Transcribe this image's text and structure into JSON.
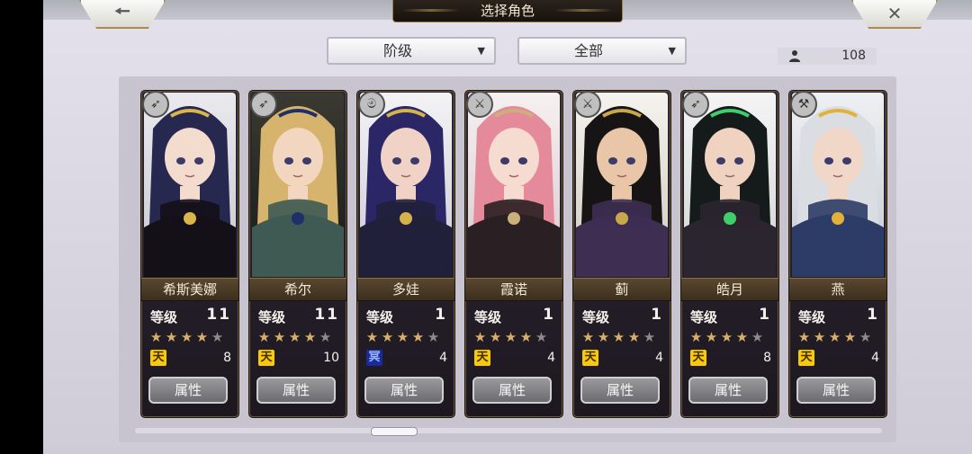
{
  "header": {
    "title": "选择角色",
    "back_icon": "back-arrow-icon",
    "close_icon": "close-x-icon"
  },
  "filters": {
    "class_filter": {
      "label": "阶级",
      "icon": "dropdown-triangle-icon"
    },
    "type_filter": {
      "label": "全部",
      "icon": "dropdown-triangle-icon"
    }
  },
  "character_count": {
    "icon": "person-icon",
    "value": "108"
  },
  "common": {
    "level_label": "等级",
    "attribute_button": "属性"
  },
  "characters": [
    {
      "name": "希斯美娜",
      "level": "11",
      "stars": 4,
      "max_stars": 5,
      "rank": "天",
      "rank_color": "#f7c80c",
      "cost": "8",
      "class_icon": "bow-icon"
    },
    {
      "name": "希尔",
      "level": "11",
      "stars": 4,
      "max_stars": 5,
      "rank": "天",
      "rank_color": "#f7c80c",
      "cost": "10",
      "class_icon": "bow-icon"
    },
    {
      "name": "多娃",
      "level": "1",
      "stars": 4,
      "max_stars": 5,
      "rank": "冥",
      "rank_color": "#1a2a9a",
      "cost": "4",
      "class_icon": "staff-icon"
    },
    {
      "name": "霞诺",
      "level": "1",
      "stars": 4,
      "max_stars": 5,
      "rank": "天",
      "rank_color": "#f7c80c",
      "cost": "4",
      "class_icon": "sword-icon"
    },
    {
      "name": "蓟",
      "level": "1",
      "stars": 4,
      "max_stars": 5,
      "rank": "天",
      "rank_color": "#f7c80c",
      "cost": "4",
      "class_icon": "sword-icon"
    },
    {
      "name": "皓月",
      "level": "1",
      "stars": 4,
      "max_stars": 5,
      "rank": "天",
      "rank_color": "#f7c80c",
      "cost": "8",
      "class_icon": "bow-icon"
    },
    {
      "name": "燕",
      "level": "1",
      "stars": 4,
      "max_stars": 5,
      "rank": "天",
      "rank_color": "#f7c80c",
      "cost": "4",
      "class_icon": "hammer-icon"
    }
  ],
  "colors": {
    "accent_gold": "#a78b52",
    "name_bar": "#4a3a26",
    "card_bg": "#221c25"
  }
}
